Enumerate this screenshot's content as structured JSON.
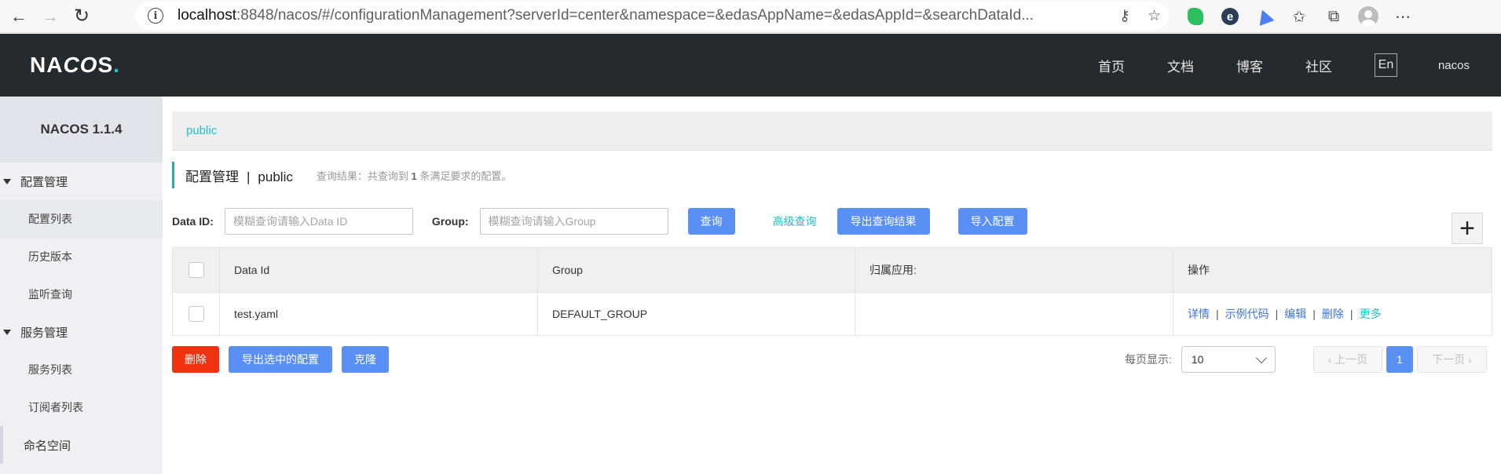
{
  "browser": {
    "url_host": "localhost",
    "url_rest": ":8848/nacos/#/configurationManagement?serverId=center&namespace=&edasAppName=&edasAppId=&searchDataId..."
  },
  "header": {
    "logo_na": "NA",
    "logo_co": "CO",
    "logo_s": "S",
    "logo_dot": ".",
    "nav": [
      "首页",
      "文档",
      "博客",
      "社区"
    ],
    "lang": "En",
    "user": "nacos"
  },
  "sidebar": {
    "title": "NACOS 1.1.4",
    "group_config": "配置管理",
    "config_items": [
      "配置列表",
      "历史版本",
      "监听查询"
    ],
    "group_service": "服务管理",
    "service_items": [
      "服务列表",
      "订阅者列表"
    ],
    "namespace": "命名空间"
  },
  "namespace_bar": {
    "current": "public"
  },
  "page": {
    "title": "配置管理",
    "separator": "|",
    "namespace": "public",
    "result_prefix": "查询结果：共查询到",
    "result_count": "1",
    "result_suffix": "条满足要求的配置。"
  },
  "search": {
    "dataid_label": "Data ID:",
    "dataid_placeholder": "模糊查询请输入Data ID",
    "group_label": "Group:",
    "group_placeholder": "模糊查询请输入Group",
    "query_button": "查询",
    "advanced_link": "高级查询",
    "export_results_button": "导出查询结果",
    "import_button": "导入配置",
    "add_button": "+"
  },
  "table": {
    "headers": [
      "Data Id",
      "Group",
      "归属应用:",
      "操作"
    ],
    "rows": [
      {
        "data_id": "test.yaml",
        "group": "DEFAULT_GROUP",
        "app": ""
      }
    ],
    "actions": [
      "详情",
      "示例代码",
      "编辑",
      "删除",
      "更多"
    ],
    "action_separator": "|"
  },
  "footer": {
    "delete_button": "删除",
    "export_selected_button": "导出选中的配置",
    "clone_button": "克隆"
  },
  "pagination": {
    "page_size_label": "每页显示:",
    "page_size": "10",
    "prev": "上一页",
    "current_page": "1",
    "next": "下一页"
  }
}
